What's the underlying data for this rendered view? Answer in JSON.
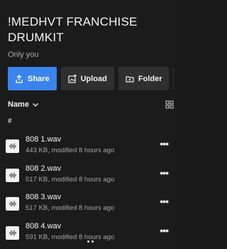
{
  "header": {
    "title": "!MEDHVT FRANCHISE DRUMKIT",
    "subtitle": "Only you"
  },
  "actions": {
    "share": "Share",
    "upload": "Upload",
    "folder": "Folder"
  },
  "sort": {
    "label": "Name"
  },
  "list_header": "#",
  "files": [
    {
      "name": "808 1.wav",
      "meta": "443 KB, modified 8 hours ago"
    },
    {
      "name": "808 2.wav",
      "meta": "517 KB, modified 8 hours ago"
    },
    {
      "name": "808 3.wav",
      "meta": "517 KB, modified 8 hours ago"
    },
    {
      "name": "808 4.wav",
      "meta": "591 KB, modified 8 hours ago"
    }
  ],
  "colors": {
    "accent": "#3a84ee",
    "background": "#1b1b1b"
  },
  "icons": [
    "share-icon",
    "upload-icon",
    "folder-icon",
    "chevron-down-icon",
    "grid-view-icon",
    "audio-file-icon",
    "more-icon"
  ]
}
